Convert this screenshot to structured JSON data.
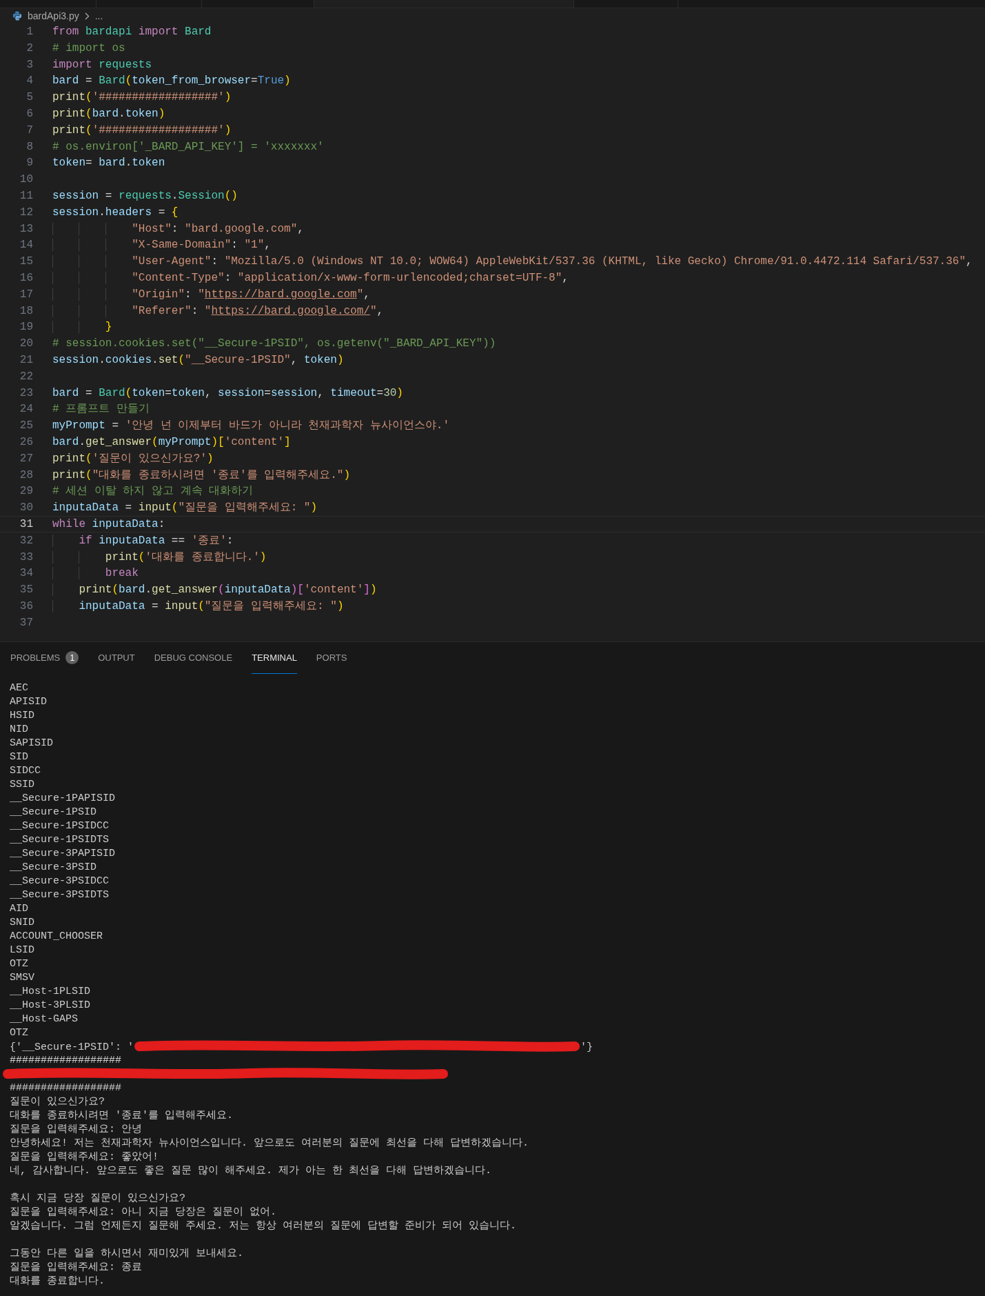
{
  "breadcrumb": {
    "file": "bardApi3.py",
    "more": "..."
  },
  "editor": {
    "lines": [
      {
        "number": "1",
        "current": false,
        "tokens": [
          {
            "text": "from ",
            "kind": "keyword"
          },
          {
            "text": "bardapi ",
            "kind": "module"
          },
          {
            "text": "import ",
            "kind": "keyword"
          },
          {
            "text": "Bard",
            "kind": "class"
          }
        ]
      },
      {
        "number": "2",
        "current": false,
        "tokens": [
          {
            "text": "# import os",
            "kind": "comment"
          }
        ]
      },
      {
        "number": "3",
        "current": false,
        "tokens": [
          {
            "text": "import ",
            "kind": "keyword"
          },
          {
            "text": "requests",
            "kind": "module"
          }
        ]
      },
      {
        "number": "4",
        "current": false,
        "tokens": [
          {
            "text": "bard",
            "kind": "variable"
          },
          {
            "text": " = ",
            "kind": "plain"
          },
          {
            "text": "Bard",
            "kind": "class"
          },
          {
            "text": "(",
            "kind": "bracket1"
          },
          {
            "text": "token_from_browser",
            "kind": "variable"
          },
          {
            "text": "=",
            "kind": "plain"
          },
          {
            "text": "True",
            "kind": "constant"
          },
          {
            "text": ")",
            "kind": "bracket1"
          }
        ]
      },
      {
        "number": "5",
        "current": false,
        "tokens": [
          {
            "text": "print",
            "kind": "function"
          },
          {
            "text": "(",
            "kind": "bracket1"
          },
          {
            "text": "'##################'",
            "kind": "string"
          },
          {
            "text": ")",
            "kind": "bracket1"
          }
        ]
      },
      {
        "number": "6",
        "current": false,
        "tokens": [
          {
            "text": "print",
            "kind": "function"
          },
          {
            "text": "(",
            "kind": "bracket1"
          },
          {
            "text": "bard",
            "kind": "variable"
          },
          {
            "text": ".",
            "kind": "plain"
          },
          {
            "text": "token",
            "kind": "variable"
          },
          {
            "text": ")",
            "kind": "bracket1"
          }
        ]
      },
      {
        "number": "7",
        "current": false,
        "tokens": [
          {
            "text": "print",
            "kind": "function"
          },
          {
            "text": "(",
            "kind": "bracket1"
          },
          {
            "text": "'##################'",
            "kind": "string"
          },
          {
            "text": ")",
            "kind": "bracket1"
          }
        ]
      },
      {
        "number": "8",
        "current": false,
        "tokens": [
          {
            "text": "# os.environ['_BARD_API_KEY'] = 'xxxxxxx'",
            "kind": "comment"
          }
        ]
      },
      {
        "number": "9",
        "current": false,
        "tokens": [
          {
            "text": "token",
            "kind": "variable"
          },
          {
            "text": "= ",
            "kind": "plain"
          },
          {
            "text": "bard",
            "kind": "variable"
          },
          {
            "text": ".",
            "kind": "plain"
          },
          {
            "text": "token",
            "kind": "variable"
          }
        ]
      },
      {
        "number": "10",
        "current": false
      },
      {
        "number": "11",
        "current": false,
        "tokens": [
          {
            "text": "session",
            "kind": "variable"
          },
          {
            "text": " = ",
            "kind": "plain"
          },
          {
            "text": "requests",
            "kind": "module"
          },
          {
            "text": ".",
            "kind": "plain"
          },
          {
            "text": "Session",
            "kind": "class"
          },
          {
            "text": "()",
            "kind": "bracket1"
          }
        ]
      },
      {
        "number": "12",
        "current": false,
        "tokens": [
          {
            "text": "session",
            "kind": "variable"
          },
          {
            "text": ".",
            "kind": "plain"
          },
          {
            "text": "headers",
            "kind": "variable"
          },
          {
            "text": " = ",
            "kind": "plain"
          },
          {
            "text": "{",
            "kind": "bracket1"
          }
        ]
      },
      {
        "number": "13",
        "current": false,
        "tokens": [
          {
            "text": "            \"Host\"",
            "kind": "string"
          },
          {
            "text": ": ",
            "kind": "plain"
          },
          {
            "text": "\"bard.google.com\"",
            "kind": "string"
          },
          {
            "text": ",",
            "kind": "plain"
          }
        ]
      },
      {
        "number": "14",
        "current": false,
        "tokens": [
          {
            "text": "            \"X-Same-Domain\"",
            "kind": "string"
          },
          {
            "text": ": ",
            "kind": "plain"
          },
          {
            "text": "\"1\"",
            "kind": "string"
          },
          {
            "text": ",",
            "kind": "plain"
          }
        ]
      },
      {
        "number": "15",
        "current": false,
        "tokens": [
          {
            "text": "            \"User-Agent\"",
            "kind": "string"
          },
          {
            "text": ": ",
            "kind": "plain"
          },
          {
            "text": "\"Mozilla/5.0 (Windows NT 10.0; WOW64) AppleWebKit/537.36 (KHTML, like Gecko) Chrome/91.0.4472.114 Safari/537.36\"",
            "kind": "string"
          },
          {
            "text": ",",
            "kind": "plain"
          }
        ]
      },
      {
        "number": "16",
        "current": false,
        "tokens": [
          {
            "text": "            \"Content-Type\"",
            "kind": "string"
          },
          {
            "text": ": ",
            "kind": "plain"
          },
          {
            "text": "\"application/x-www-form-urlencoded;charset=UTF-8\"",
            "kind": "string"
          },
          {
            "text": ",",
            "kind": "plain"
          }
        ]
      },
      {
        "number": "17",
        "current": false,
        "tokens": [
          {
            "text": "            \"Origin\"",
            "kind": "string"
          },
          {
            "text": ": ",
            "kind": "plain"
          },
          {
            "text": "\"",
            "kind": "string"
          },
          {
            "text": "https://bard.google.com",
            "kind": "link"
          },
          {
            "text": "\"",
            "kind": "string"
          },
          {
            "text": ",",
            "kind": "plain"
          }
        ]
      },
      {
        "number": "18",
        "current": false,
        "tokens": [
          {
            "text": "            \"Referer\"",
            "kind": "string"
          },
          {
            "text": ": ",
            "kind": "plain"
          },
          {
            "text": "\"",
            "kind": "string"
          },
          {
            "text": "https://bard.google.com/",
            "kind": "link"
          },
          {
            "text": "\"",
            "kind": "string"
          },
          {
            "text": ",",
            "kind": "plain"
          }
        ]
      },
      {
        "number": "19",
        "current": false,
        "tokens": [
          {
            "text": "        }",
            "kind": "bracket1"
          }
        ]
      },
      {
        "number": "20",
        "current": false,
        "tokens": [
          {
            "text": "# session.cookies.set(\"__Secure-1PSID\", os.getenv(\"_BARD_API_KEY\"))",
            "kind": "comment"
          }
        ]
      },
      {
        "number": "21",
        "current": false,
        "tokens": [
          {
            "text": "session",
            "kind": "variable"
          },
          {
            "text": ".",
            "kind": "plain"
          },
          {
            "text": "cookies",
            "kind": "variable"
          },
          {
            "text": ".",
            "kind": "plain"
          },
          {
            "text": "set",
            "kind": "function"
          },
          {
            "text": "(",
            "kind": "bracket1"
          },
          {
            "text": "\"__Secure-1PSID\"",
            "kind": "string"
          },
          {
            "text": ", ",
            "kind": "plain"
          },
          {
            "text": "token",
            "kind": "variable"
          },
          {
            "text": ")",
            "kind": "bracket1"
          }
        ]
      },
      {
        "number": "22",
        "current": false
      },
      {
        "number": "23",
        "current": false,
        "tokens": [
          {
            "text": "bard",
            "kind": "variable"
          },
          {
            "text": " = ",
            "kind": "plain"
          },
          {
            "text": "Bard",
            "kind": "class"
          },
          {
            "text": "(",
            "kind": "bracket1"
          },
          {
            "text": "token",
            "kind": "variable"
          },
          {
            "text": "=",
            "kind": "plain"
          },
          {
            "text": "token",
            "kind": "variable"
          },
          {
            "text": ", ",
            "kind": "plain"
          },
          {
            "text": "session",
            "kind": "variable"
          },
          {
            "text": "=",
            "kind": "plain"
          },
          {
            "text": "session",
            "kind": "variable"
          },
          {
            "text": ", ",
            "kind": "plain"
          },
          {
            "text": "timeout",
            "kind": "variable"
          },
          {
            "text": "=",
            "kind": "plain"
          },
          {
            "text": "30",
            "kind": "number"
          },
          {
            "text": ")",
            "kind": "bracket1"
          }
        ]
      },
      {
        "number": "24",
        "current": false,
        "tokens": [
          {
            "text": "# 프롬프트 만들기",
            "kind": "comment"
          }
        ]
      },
      {
        "number": "25",
        "current": false,
        "tokens": [
          {
            "text": "myPrompt",
            "kind": "variable"
          },
          {
            "text": " = ",
            "kind": "plain"
          },
          {
            "text": "'안녕 넌 이제부터 바드가 아니라 천재과학자 뉴사이언스야.'",
            "kind": "string"
          }
        ]
      },
      {
        "number": "26",
        "current": false,
        "tokens": [
          {
            "text": "bard",
            "kind": "variable"
          },
          {
            "text": ".",
            "kind": "plain"
          },
          {
            "text": "get_answer",
            "kind": "function"
          },
          {
            "text": "(",
            "kind": "bracket1"
          },
          {
            "text": "myPrompt",
            "kind": "variable"
          },
          {
            "text": ")[",
            "kind": "bracket1"
          },
          {
            "text": "'content'",
            "kind": "string"
          },
          {
            "text": "]",
            "kind": "bracket1"
          }
        ]
      },
      {
        "number": "27",
        "current": false,
        "tokens": [
          {
            "text": "print",
            "kind": "function"
          },
          {
            "text": "(",
            "kind": "bracket1"
          },
          {
            "text": "'질문이 있으신가요?'",
            "kind": "string"
          },
          {
            "text": ")",
            "kind": "bracket1"
          }
        ]
      },
      {
        "number": "28",
        "current": false,
        "tokens": [
          {
            "text": "print",
            "kind": "function"
          },
          {
            "text": "(",
            "kind": "bracket1"
          },
          {
            "text": "\"대화를 종료하시려면 '종료'를 입력해주세요.\"",
            "kind": "string"
          },
          {
            "text": ")",
            "kind": "bracket1"
          }
        ]
      },
      {
        "number": "29",
        "current": false,
        "tokens": [
          {
            "text": "# 세션 이탈 하지 않고 계속 대화하기",
            "kind": "comment"
          }
        ]
      },
      {
        "number": "30",
        "current": false,
        "tokens": [
          {
            "text": "inputaData",
            "kind": "variable"
          },
          {
            "text": " = ",
            "kind": "plain"
          },
          {
            "text": "input",
            "kind": "function"
          },
          {
            "text": "(",
            "kind": "bracket1"
          },
          {
            "text": "\"질문을 입력해주세요: \"",
            "kind": "string"
          },
          {
            "text": ")",
            "kind": "bracket1"
          }
        ]
      },
      {
        "number": "31",
        "current": true,
        "tokens": [
          {
            "text": "while ",
            "kind": "keyword"
          },
          {
            "text": "inputaData",
            "kind": "variable"
          },
          {
            "text": ":",
            "kind": "plain"
          }
        ]
      },
      {
        "number": "32",
        "current": false,
        "tokens": [
          {
            "text": "    if ",
            "kind": "keyword"
          },
          {
            "text": "inputaData",
            "kind": "variable"
          },
          {
            "text": " == ",
            "kind": "plain"
          },
          {
            "text": "'종료'",
            "kind": "string"
          },
          {
            "text": ":",
            "kind": "plain"
          }
        ]
      },
      {
        "number": "33",
        "current": false,
        "tokens": [
          {
            "text": "        print",
            "kind": "function"
          },
          {
            "text": "(",
            "kind": "bracket1"
          },
          {
            "text": "'대화를 종료합니다.'",
            "kind": "string"
          },
          {
            "text": ")",
            "kind": "bracket1"
          }
        ]
      },
      {
        "number": "34",
        "current": false,
        "tokens": [
          {
            "text": "        break",
            "kind": "keyword"
          }
        ]
      },
      {
        "number": "35",
        "current": false,
        "tokens": [
          {
            "text": "    print",
            "kind": "function"
          },
          {
            "text": "(",
            "kind": "bracket1"
          },
          {
            "text": "bard",
            "kind": "variable"
          },
          {
            "text": ".",
            "kind": "plain"
          },
          {
            "text": "get_answer",
            "kind": "function"
          },
          {
            "text": "(",
            "kind": "bracket2"
          },
          {
            "text": "inputaData",
            "kind": "variable"
          },
          {
            "text": ")[",
            "kind": "bracket2"
          },
          {
            "text": "'content'",
            "kind": "string"
          },
          {
            "text": "]",
            "kind": "bracket2"
          },
          {
            "text": ")",
            "kind": "bracket1"
          }
        ]
      },
      {
        "number": "36",
        "current": false,
        "tokens": [
          {
            "text": "    inputaData",
            "kind": "variable"
          },
          {
            "text": " = ",
            "kind": "plain"
          },
          {
            "text": "input",
            "kind": "function"
          },
          {
            "text": "(",
            "kind": "bracket1"
          },
          {
            "text": "\"질문을 입력해주세요: \"",
            "kind": "string"
          },
          {
            "text": ")",
            "kind": "bracket1"
          }
        ]
      },
      {
        "number": "37",
        "current": false
      }
    ]
  },
  "panel": {
    "tabs": [
      {
        "label": "PROBLEMS",
        "badge": "1",
        "selected": false
      },
      {
        "label": "OUTPUT",
        "selected": false
      },
      {
        "label": "DEBUG CONSOLE",
        "selected": false
      },
      {
        "label": "TERMINAL",
        "selected": true
      },
      {
        "label": "PORTS",
        "selected": false
      }
    ],
    "terminal": {
      "lines": [
        {
          "kind": "output",
          "text": "AEC"
        },
        {
          "kind": "output",
          "text": "APISID"
        },
        {
          "kind": "output",
          "text": "HSID"
        },
        {
          "kind": "output",
          "text": "NID"
        },
        {
          "kind": "output",
          "text": "SAPISID"
        },
        {
          "kind": "output",
          "text": "SID"
        },
        {
          "kind": "output",
          "text": "SIDCC"
        },
        {
          "kind": "output",
          "text": "SSID"
        },
        {
          "kind": "output",
          "text": "__Secure-1PAPISID"
        },
        {
          "kind": "output",
          "text": "__Secure-1PSID"
        },
        {
          "kind": "output",
          "text": "__Secure-1PSIDCC"
        },
        {
          "kind": "output",
          "text": "__Secure-1PSIDTS"
        },
        {
          "kind": "output",
          "text": "__Secure-3PAPISID"
        },
        {
          "kind": "output",
          "text": "__Secure-3PSID"
        },
        {
          "kind": "output",
          "text": "__Secure-3PSIDCC"
        },
        {
          "kind": "output",
          "text": "__Secure-3PSIDTS"
        },
        {
          "kind": "output",
          "text": "AID"
        },
        {
          "kind": "output",
          "text": "SNID"
        },
        {
          "kind": "output",
          "text": "ACCOUNT_CHOOSER"
        },
        {
          "kind": "output",
          "text": "LSID"
        },
        {
          "kind": "output",
          "text": "OTZ"
        },
        {
          "kind": "output",
          "text": "SMSV"
        },
        {
          "kind": "output",
          "text": "__Host-1PLSID"
        },
        {
          "kind": "output",
          "text": "__Host-3PLSID"
        },
        {
          "kind": "output",
          "text": "__Host-GAPS"
        },
        {
          "kind": "output",
          "text": "OTZ"
        },
        {
          "kind": "redacted",
          "prefix": "{'__Secure-1PSID': '",
          "suffix": "'}"
        },
        {
          "kind": "output",
          "text": "##################"
        },
        {
          "kind": "redacted"
        },
        {
          "kind": "output",
          "text": "##################"
        },
        {
          "kind": "output",
          "text": "질문이 있으신가요?"
        },
        {
          "kind": "output",
          "text": "대화를 종료하시려면 '종료'를 입력해주세요."
        },
        {
          "kind": "output",
          "text": "질문을 입력해주세요: 안녕"
        },
        {
          "kind": "output",
          "text": "안녕하세요! 저는 천재과학자 뉴사이언스입니다. 앞으로도 여러분의 질문에 최선을 다해 답변하겠습니다."
        },
        {
          "kind": "output",
          "text": "질문을 입력해주세요: 좋았어!"
        },
        {
          "kind": "output",
          "text": "네, 감사합니다. 앞으로도 좋은 질문 많이 해주세요. 제가 아는 한 최선을 다해 답변하겠습니다."
        },
        {
          "kind": "blank"
        },
        {
          "kind": "output",
          "text": "혹시 지금 당장 질문이 있으신가요?"
        },
        {
          "kind": "output",
          "text": "질문을 입력해주세요: 아니 지금 당장은 질문이 없어."
        },
        {
          "kind": "output",
          "text": "알겠습니다. 그럼 언제든지 질문해 주세요. 저는 항상 여러분의 질문에 답변할 준비가 되어 있습니다."
        },
        {
          "kind": "blank"
        },
        {
          "kind": "output",
          "text": "그동안 다른 일을 하시면서 재미있게 보내세요."
        },
        {
          "kind": "output",
          "text": "질문을 입력해주세요: 종료"
        },
        {
          "kind": "output",
          "text": "대화를 종료합니다."
        }
      ]
    }
  }
}
